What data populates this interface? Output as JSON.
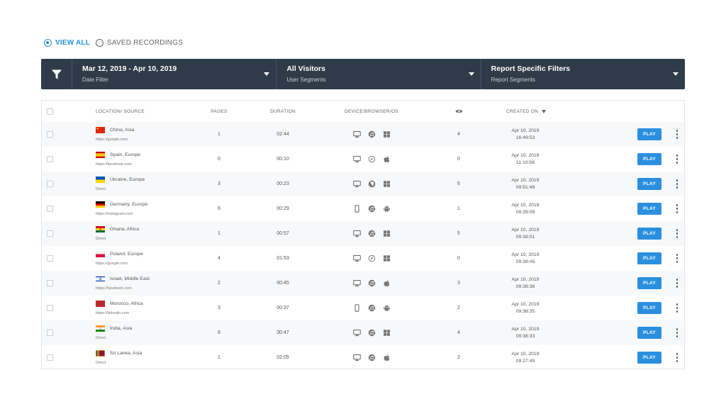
{
  "view_toggle": {
    "view_all": "VIEW ALL",
    "saved_recordings": "SAVED RECORDINGS"
  },
  "filters": [
    {
      "title": "Mar 12, 2019 - Apr 10, 2019",
      "subtitle": "Date Filter"
    },
    {
      "title": "All Visitors",
      "subtitle": "User Segments"
    },
    {
      "title": "Report Specific Filters",
      "subtitle": "Report Segments"
    }
  ],
  "table": {
    "headers": {
      "location": "LOCATION/ SOURCE",
      "pages": "PAGES",
      "duration": "DURATION",
      "device": "DEVICE/BROWSER/OS",
      "created": "CREATED ON"
    },
    "play_label": "PLAY",
    "rows": [
      {
        "location": "China, Asia",
        "source": "https://google.com",
        "pages": "1",
        "duration": "02:44",
        "device": "desktop-icon",
        "browser": "chrome-icon",
        "os": "windows-icon",
        "views": "4",
        "date": "Apr 10, 2019",
        "time": "16:49:53",
        "flag": "china-flag-icon"
      },
      {
        "location": "Spain, Europe",
        "source": "https://facebook.com",
        "pages": "0",
        "duration": "00:10",
        "device": "desktop-icon",
        "browser": "safari-icon",
        "os": "apple-icon",
        "views": "0",
        "date": "Apr 10, 2019",
        "time": "11:10:56",
        "flag": "spain-flag-icon"
      },
      {
        "location": "Ukraine, Europe",
        "source": "Direct",
        "pages": "3",
        "duration": "00:23",
        "device": "desktop-icon",
        "browser": "firefox-icon",
        "os": "windows-icon",
        "views": "6",
        "date": "Apr 10, 2019",
        "time": "09:51:49",
        "flag": "ukraine-flag-icon"
      },
      {
        "location": "Germany, Europe",
        "source": "https://instagram.com",
        "pages": "6",
        "duration": "00:29",
        "device": "mobile-icon",
        "browser": "chrome-icon",
        "os": "android-icon",
        "views": "1",
        "date": "Apr 10, 2019",
        "time": "09:39:09",
        "flag": "germany-flag-icon"
      },
      {
        "location": "Ghana, Africa",
        "source": "Direct",
        "pages": "1",
        "duration": "00:57",
        "device": "desktop-icon",
        "browser": "chrome-icon",
        "os": "windows-icon",
        "views": "5",
        "date": "Apr 10, 2019",
        "time": "09:39:01",
        "flag": "ghana-flag-icon"
      },
      {
        "location": "Poland, Europe",
        "source": "https://google.com",
        "pages": "4",
        "duration": "01:53",
        "device": "desktop-icon",
        "browser": "safari-icon",
        "os": "windows-icon",
        "views": "0",
        "date": "Apr 10, 2019",
        "time": "09:39:45",
        "flag": "poland-flag-icon"
      },
      {
        "location": "Israel, Middle East",
        "source": "https://facebook.com",
        "pages": "2",
        "duration": "00:45",
        "device": "desktop-icon",
        "browser": "chrome-icon",
        "os": "apple-icon",
        "views": "3",
        "date": "Apr 10, 2019",
        "time": "09:39:38",
        "flag": "israel-flag-icon"
      },
      {
        "location": "Morocco, Africa",
        "source": "https://linkedin.com",
        "pages": "3",
        "duration": "00:37",
        "device": "mobile-icon",
        "browser": "chrome-icon",
        "os": "android-icon",
        "views": "2",
        "date": "Apr 10, 2019",
        "time": "09:38:35",
        "flag": "morocco-flag-icon"
      },
      {
        "location": "India, Asia",
        "source": "Direct",
        "pages": "6",
        "duration": "00:47",
        "device": "desktop-icon",
        "browser": "chrome-icon",
        "os": "windows-icon",
        "views": "4",
        "date": "Apr 10, 2019",
        "time": "09:38:33",
        "flag": "india-flag-icon"
      },
      {
        "location": "Sri Lanka, Asia",
        "source": "Direct",
        "pages": "1",
        "duration": "02:05",
        "device": "desktop-icon",
        "browser": "chrome-icon",
        "os": "apple-icon",
        "views": "2",
        "date": "Apr 10, 2019",
        "time": "09:27:49",
        "flag": "sri-lanka-flag-icon"
      }
    ]
  },
  "colors": {
    "accent": "#2b8fe0",
    "filter_bar": "#2f3b48",
    "zebra": "#f7f8f9"
  }
}
